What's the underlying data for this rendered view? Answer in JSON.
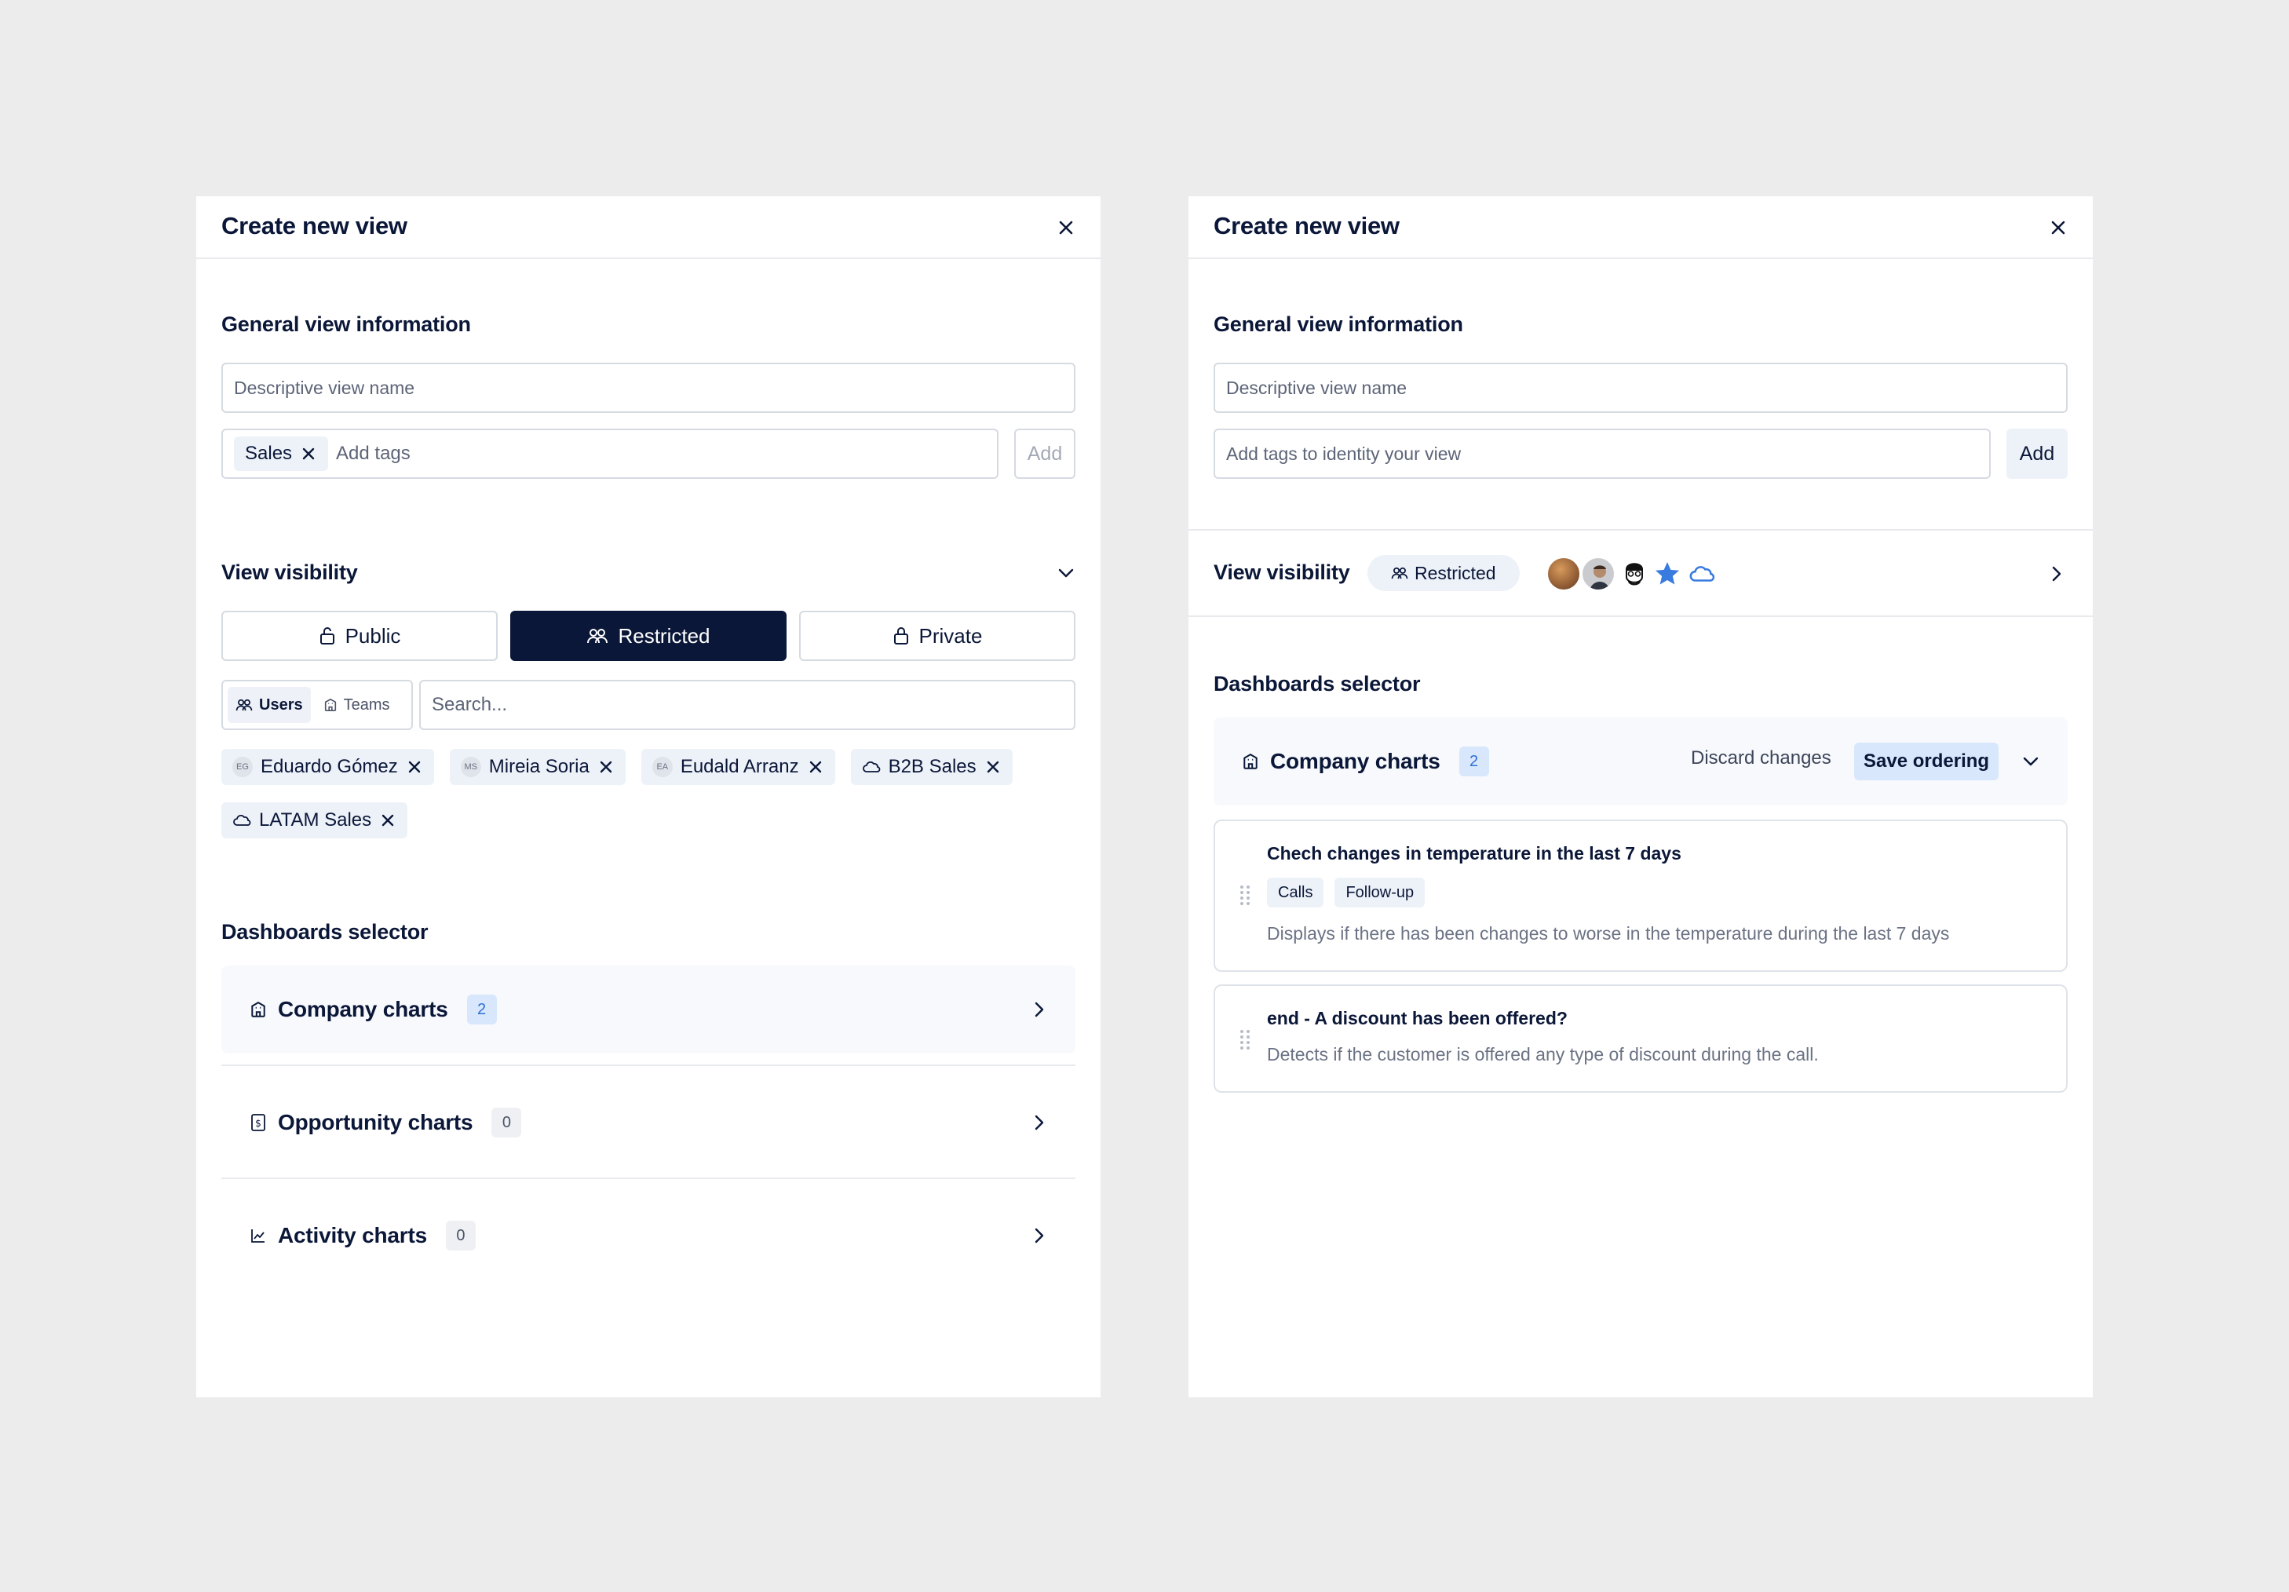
{
  "left": {
    "title": "Create new view",
    "general_title": "General view information",
    "name_placeholder": "Descriptive view name",
    "tag_chip": "Sales",
    "tags_placeholder": "Add tags",
    "add_label": "Add",
    "visibility_title": "View visibility",
    "visibility_options": {
      "public": "Public",
      "restricted": "Restricted",
      "private": "Private"
    },
    "visibility_selected": "Restricted",
    "toggle": {
      "users": "Users",
      "teams": "Teams"
    },
    "search_placeholder": "Search...",
    "selected_members": [
      {
        "initials": "EG",
        "name": "Eduardo Gómez"
      },
      {
        "initials": "MS",
        "name": "Mireia Soria"
      },
      {
        "initials": "EA",
        "name": "Eudald Arranz"
      },
      {
        "initials": "",
        "name": "B2B Sales"
      },
      {
        "initials": "",
        "name": "LATAM Sales"
      }
    ],
    "dashboards_title": "Dashboards selector",
    "dashboards": [
      {
        "label": "Company charts",
        "count": "2",
        "icon": "building-icon"
      },
      {
        "label": "Opportunity charts",
        "count": "0",
        "icon": "dollar-doc-icon"
      },
      {
        "label": "Activity charts",
        "count": "0",
        "icon": "chart-line-icon"
      }
    ]
  },
  "right": {
    "title": "Create new view",
    "general_title": "General view information",
    "name_placeholder": "Descriptive view name",
    "tags_placeholder": "Add tags to identity your view",
    "add_label": "Add",
    "visibility_title": "View visibility",
    "visibility_badge": "Restricted",
    "dashboards_title": "Dashboards selector",
    "group": {
      "label": "Company charts",
      "count": "2",
      "discard": "Discard changes",
      "save": "Save ordering"
    },
    "cards": [
      {
        "title": "Chech changes in temperature in the last 7 days",
        "tags": [
          "Calls",
          "Follow-up"
        ],
        "desc": "Displays if there has been changes to worse in the temperature during the last 7 days"
      },
      {
        "title": "end - A discount has been offered?",
        "desc": "Detects if the customer is offered any type of discount during the call."
      }
    ]
  },
  "colors": {
    "primary": "#0b1738",
    "accent": "#2f6fd6",
    "chip": "#edf2f9",
    "highlight": "#d8e7fb"
  }
}
